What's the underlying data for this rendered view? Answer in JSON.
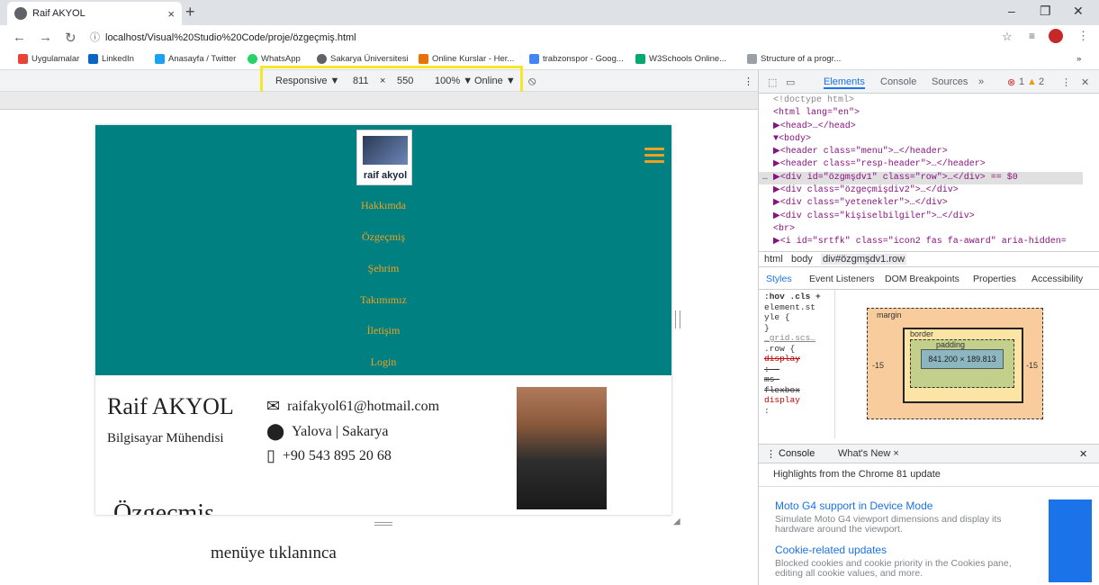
{
  "browser": {
    "tab_title": "Raif AKYOL",
    "url": "localhost/Visual%20Studio%20Code/proje/özgeçmiş.html",
    "new_tab": "+",
    "tab_close": "×"
  },
  "bookmarks": [
    {
      "label": "Uygulamalar",
      "color": "#ea4335"
    },
    {
      "label": "LinkedIn",
      "color": "#0a66c2"
    },
    {
      "label": "Anasayfa / Twitter",
      "color": "#1da1f2"
    },
    {
      "label": "WhatsApp",
      "color": "#25d366"
    },
    {
      "label": "Sakarya Üniversitesi",
      "color": "#5f6368"
    },
    {
      "label": "Online Kurslar - Her...",
      "color": "#e8710a"
    },
    {
      "label": "trabzonspor - Goog...",
      "color": "#4285f4"
    },
    {
      "label": "W3Schools Online...",
      "color": "#04aa6d"
    },
    {
      "label": "Structure of a progr...",
      "color": "#9aa0a6"
    }
  ],
  "device_toolbar": {
    "device": "Responsive ▼",
    "width": "811",
    "times": "×",
    "height": "550",
    "zoom": "100% ▼",
    "network": "Online ▼"
  },
  "site": {
    "logo_text": "raif akyol",
    "menu": [
      "Hakkımda",
      "Özgeçmiş",
      "Şehrim",
      "Takımımız",
      "İletişim",
      "Login"
    ],
    "name": "Raif AKYOL",
    "job": "Bilgisayar Mühendisi",
    "email": "raifakyol61@hotmail.com",
    "location": "Yalova | Sakarya",
    "phone": "+90 543 895 20 68",
    "cut_heading": "Özgeçmiş",
    "accent": "#f0a020",
    "background": "#008080"
  },
  "caption": "menüye tıklanınca",
  "devtools": {
    "tabs": [
      "Elements",
      "Console",
      "Sources",
      "»"
    ],
    "errors": "1",
    "warnings": "2",
    "dom": [
      "<!doctype html>",
      "<html lang=\"en\">",
      "  ▶<head>…</head>",
      "  ▼<body>",
      "    ▶<header class=\"menu\">…</header>",
      "    ▶<header class=\"resp-header\">…</header>",
      "… ▶<div id=\"özgmşdv1\" class=\"row\">…</div> == $0",
      "    ▶<div class=\"özgeçmişdiv2\">…</div>",
      "    ▶<div class=\"yetenekler\">…</div>",
      "    ▶<div class=\"kişiselbilgiler\">…</div>",
      "     <br>",
      "    ▶<i id=\"srtfk\" class=\"icon2 fas fa-award\" aria-hidden="
    ],
    "breadcrumb": [
      "html",
      "body",
      "div#özgmşdv1.row"
    ],
    "style_tabs": [
      "Styles",
      "Event Listeners",
      "DOM Breakpoints",
      "Properties",
      "Accessibility"
    ],
    "styles": [
      ":hov .cls +",
      "element.st",
      "yle {",
      "}",
      "_grid.scs…",
      ".row {",
      "  display",
      "    : -",
      "    ms-",
      "    flexbox",
      "  display",
      "    :"
    ],
    "box": {
      "margin": "margin",
      "border": "border",
      "padding": "padding",
      "content": "841.200 × 189.813",
      "left": "-15",
      "right": "-15",
      "dash": "–"
    },
    "drawer_tabs": [
      "Console",
      "What's New ×"
    ],
    "whats_new": {
      "header": "Highlights from the Chrome 81 update",
      "items": [
        {
          "title": "Moto G4 support in Device Mode",
          "desc": "Simulate Moto G4 viewport dimensions and display its hardware around the viewport."
        },
        {
          "title": "Cookie-related updates",
          "desc": "Blocked cookies and cookie priority in the Cookies pane, editing all cookie values, and more."
        }
      ]
    }
  }
}
